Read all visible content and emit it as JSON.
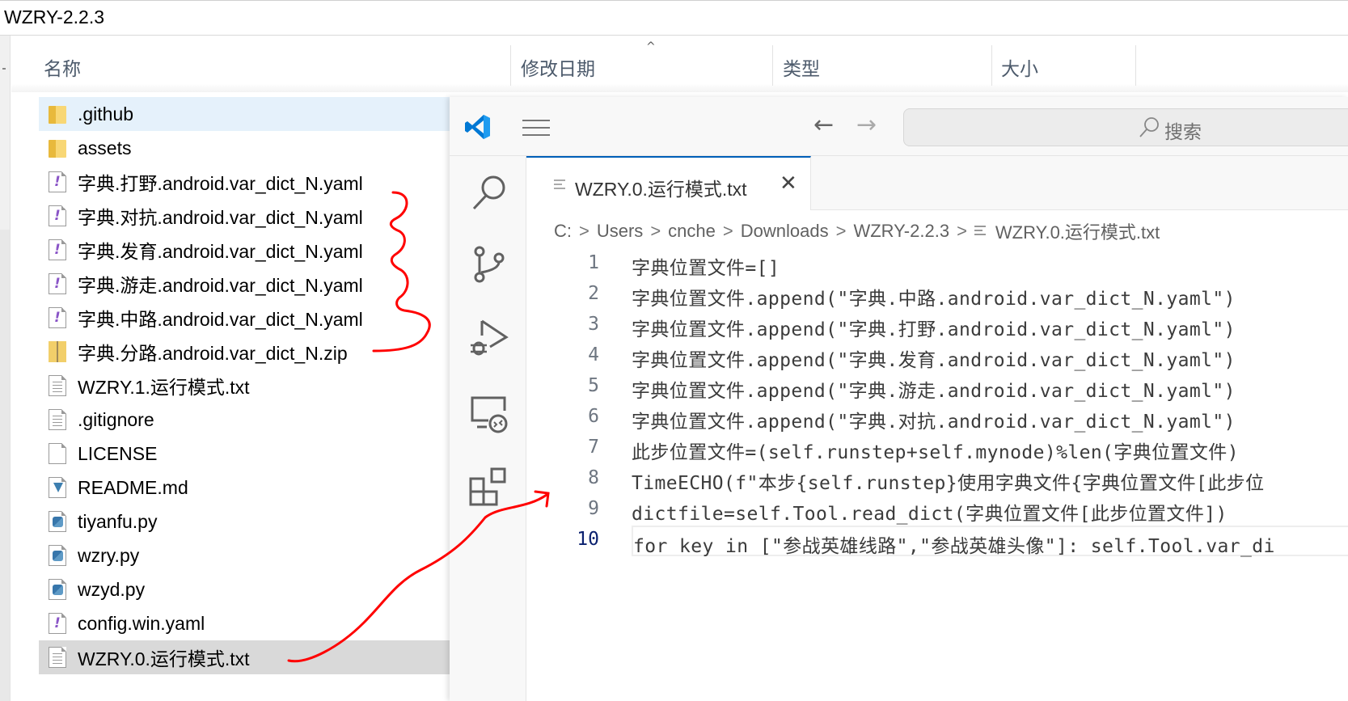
{
  "explorer": {
    "title": "WZRY-2.2.3",
    "columns": [
      "名称",
      "修改日期",
      "类型",
      "大小"
    ],
    "sort_indicator": "^",
    "files": [
      {
        "name": ".github",
        "icon": "folder-icon",
        "state": "hover"
      },
      {
        "name": "assets",
        "icon": "folder-icon",
        "state": ""
      },
      {
        "name": "字典.打野.android.var_dict_N.yaml",
        "icon": "yaml-file-icon",
        "state": ""
      },
      {
        "name": "字典.对抗.android.var_dict_N.yaml",
        "icon": "yaml-file-icon",
        "state": ""
      },
      {
        "name": "字典.发育.android.var_dict_N.yaml",
        "icon": "yaml-file-icon",
        "state": ""
      },
      {
        "name": "字典.游走.android.var_dict_N.yaml",
        "icon": "yaml-file-icon",
        "state": ""
      },
      {
        "name": "字典.中路.android.var_dict_N.yaml",
        "icon": "yaml-file-icon",
        "state": ""
      },
      {
        "name": "字典.分路.android.var_dict_N.zip",
        "icon": "zip-file-icon",
        "state": ""
      },
      {
        "name": "WZRY.1.运行模式.txt",
        "icon": "text-file-icon",
        "state": ""
      },
      {
        "name": ".gitignore",
        "icon": "text-file-icon",
        "state": ""
      },
      {
        "name": "LICENSE",
        "icon": "blank-file-icon",
        "state": ""
      },
      {
        "name": "README.md",
        "icon": "markdown-file-icon",
        "state": ""
      },
      {
        "name": "tiyanfu.py",
        "icon": "python-file-icon",
        "state": ""
      },
      {
        "name": "wzry.py",
        "icon": "python-file-icon",
        "state": ""
      },
      {
        "name": "wzyd.py",
        "icon": "python-file-icon",
        "state": ""
      },
      {
        "name": "config.win.yaml",
        "icon": "yaml-file-icon",
        "state": ""
      },
      {
        "name": "WZRY.0.运行模式.txt",
        "icon": "text-file-icon",
        "state": "selected"
      }
    ]
  },
  "vscode": {
    "search_placeholder": "搜索",
    "nav": {
      "back": "←",
      "forward": "→"
    },
    "activity_bar": [
      "search-icon",
      "source-control-icon",
      "run-debug-icon",
      "remote-explorer-icon",
      "extensions-icon"
    ],
    "tab": {
      "label": "WZRY.0.运行模式.txt",
      "close": "✕"
    },
    "breadcrumb": [
      "C:",
      "Users",
      "cnche",
      "Downloads",
      "WZRY-2.2.3",
      "WZRY.0.运行模式.txt"
    ],
    "breadcrumb_sep": ">",
    "current_line": 10,
    "lines": [
      {
        "n": "1",
        "text": "字典位置文件=[]"
      },
      {
        "n": "2",
        "text": "字典位置文件.append(\"字典.中路.android.var_dict_N.yaml\")"
      },
      {
        "n": "3",
        "text": "字典位置文件.append(\"字典.打野.android.var_dict_N.yaml\")"
      },
      {
        "n": "4",
        "text": "字典位置文件.append(\"字典.发育.android.var_dict_N.yaml\")"
      },
      {
        "n": "5",
        "text": "字典位置文件.append(\"字典.游走.android.var_dict_N.yaml\")"
      },
      {
        "n": "6",
        "text": "字典位置文件.append(\"字典.对抗.android.var_dict_N.yaml\")"
      },
      {
        "n": "7",
        "text": "此步位置文件=(self.runstep+self.mynode)%len(字典位置文件)"
      },
      {
        "n": "8",
        "text": "TimeECHO(f\"本步{self.runstep}使用字典文件{字典位置文件[此步位"
      },
      {
        "n": "9",
        "text": "dictfile=self.Tool.read_dict(字典位置文件[此步位置文件])"
      },
      {
        "n": "10",
        "text": "for key in [\"参战英雄线路\",\"参战英雄头像\"]: self.Tool.var_di"
      }
    ]
  },
  "annotation_color": "#ff0000"
}
